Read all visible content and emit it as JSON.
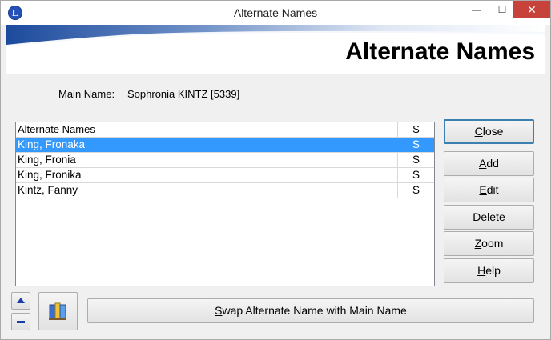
{
  "window": {
    "title": "Alternate Names",
    "app_icon_letter": "L",
    "controls": {
      "minimize": "—",
      "maximize": "☐",
      "close": "✕"
    }
  },
  "banner": {
    "title": "Alternate Names"
  },
  "main_name": {
    "label": "Main Name:",
    "value": "Sophronia KINTZ [5339]"
  },
  "list": {
    "columns": [
      "Alternate Names",
      "S"
    ],
    "rows": [
      {
        "name": "King, Fronaka",
        "s": "S",
        "selected": true
      },
      {
        "name": "King, Fronia",
        "s": "S",
        "selected": false
      },
      {
        "name": "King, Fronika",
        "s": "S",
        "selected": false
      },
      {
        "name": "Kintz, Fanny",
        "s": "S",
        "selected": false
      }
    ]
  },
  "buttons": {
    "close": {
      "hotkey": "C",
      "rest": "lose"
    },
    "add": {
      "hotkey": "A",
      "rest": "dd"
    },
    "edit": {
      "hotkey": "E",
      "rest": "dit"
    },
    "delete": {
      "hotkey": "D",
      "rest": "elete"
    },
    "zoom": {
      "hotkey": "Z",
      "rest": "oom"
    },
    "help": {
      "hotkey": "H",
      "rest": "elp"
    },
    "swap": {
      "hotkey": "S",
      "rest": "wap Alternate Name with Main Name"
    }
  },
  "icons": {
    "move_up": "arrow-up-icon",
    "move_down": "minus-icon",
    "sources": "book-icon"
  },
  "colors": {
    "selection": "#3399ff",
    "banner_blue": "#1f4fa0",
    "title_close": "#c7423b"
  }
}
